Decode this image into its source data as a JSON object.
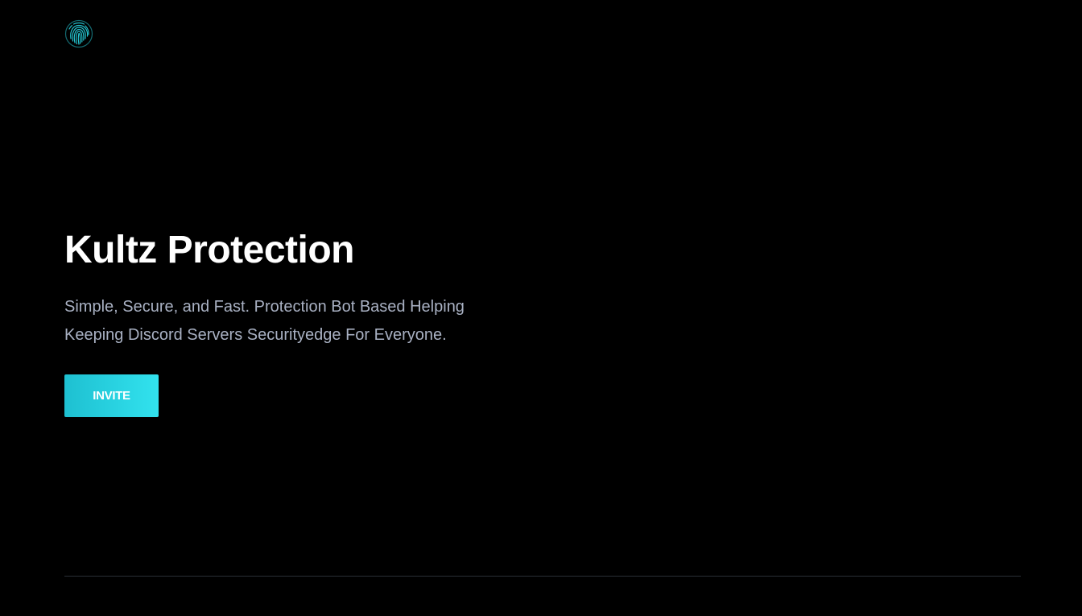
{
  "header": {
    "logo_icon": "fingerprint-icon",
    "logo_color": "#24c3cf"
  },
  "hero": {
    "title": "Kultz Protection",
    "subtitle": "Simple, Secure, and Fast. Protection Bot Based Helping Keeping Discord Servers Securityedge For Everyone.",
    "invite_label": "INVITE"
  },
  "colors": {
    "background": "#000000",
    "title": "#ffffff",
    "subtitle": "#a9b1c3",
    "accent_start": "#1ec0d1",
    "accent_end": "#32e2ee",
    "divider": "#2a2f36"
  }
}
